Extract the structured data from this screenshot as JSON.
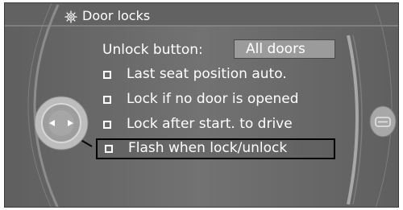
{
  "header": {
    "title": "Door locks",
    "icon": "gear-icon"
  },
  "settings": {
    "unlock_button": {
      "label": "Unlock button:",
      "value": "All doors"
    },
    "options": [
      {
        "label": "Last seat position auto.",
        "checked": false,
        "selected": false
      },
      {
        "label": "Lock if no door is opened",
        "checked": false,
        "selected": false
      },
      {
        "label": "Lock after start. to drive",
        "checked": false,
        "selected": false
      },
      {
        "label": "Flash when lock/unlock",
        "checked": false,
        "selected": true
      }
    ]
  },
  "controls": {
    "controller_icon": "idrive-controller-icon",
    "right_button_icon": "option-button-icon"
  }
}
